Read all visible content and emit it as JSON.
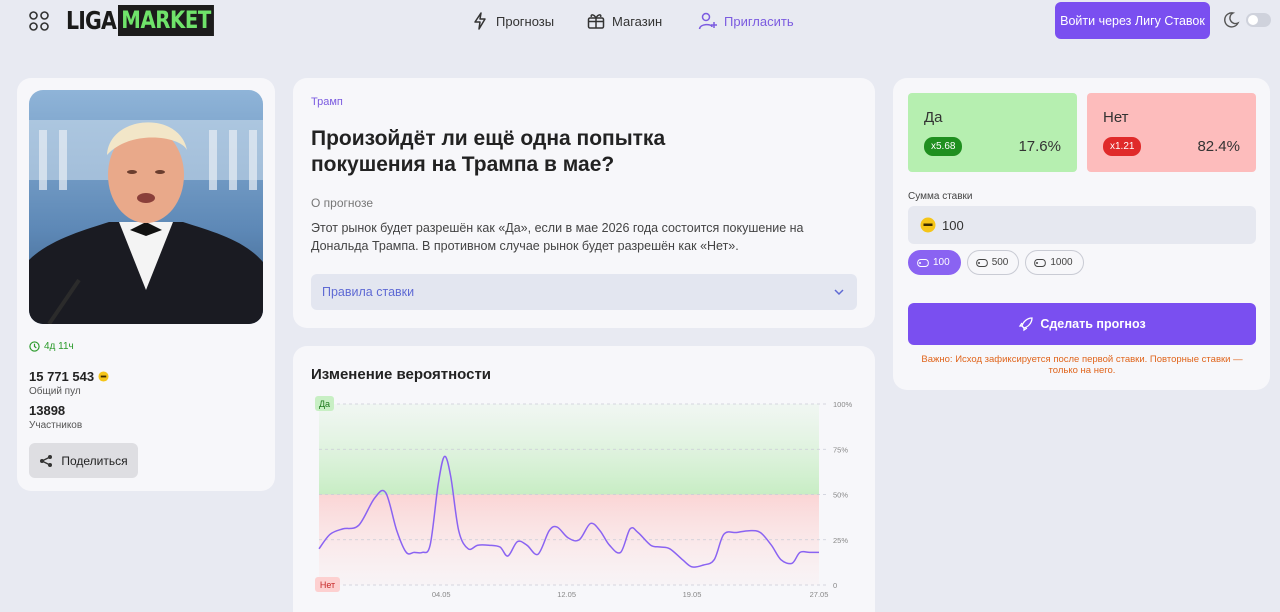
{
  "header": {
    "logo_left": "LIGA",
    "logo_right": "MARKET",
    "nav": [
      {
        "label": "Прогнозы",
        "icon": "lightning-icon"
      },
      {
        "label": "Магазин",
        "icon": "gift-icon"
      },
      {
        "label": "Пригласить",
        "icon": "add-user-icon"
      }
    ],
    "login_label": "Войти через Лигу Ставок"
  },
  "left": {
    "time_left": "4д 11ч",
    "pool_value": "15 771 543",
    "pool_label": "Общий пул",
    "participants_value": "13898",
    "participants_label": "Участников",
    "share_label": "Поделиться"
  },
  "market": {
    "tag": "Трамп",
    "title": "Произойдёт ли ещё одна попытка покушения на Трампа в мае?",
    "about_label": "О прогнозе",
    "about_text": "Этот рынок будет разрешён как «Да», если в мае 2026 года состоится покушение на Дональда Трампа. В противном случае рынок будет разрешён как «Нет».",
    "rules_label": "Правила ставки"
  },
  "chart_card": {
    "title": "Изменение вероятности"
  },
  "chart_data": {
    "type": "line",
    "title": "Изменение вероятности",
    "xlabel": "",
    "ylabel": "",
    "ylim": [
      0,
      100
    ],
    "y_ticks": [
      "0",
      "25%",
      "50%",
      "75%",
      "100%"
    ],
    "x_tick_labels": [
      "04.05",
      "12.05",
      "19.05",
      "27.05"
    ],
    "x_tick_positions": [
      9.2,
      17.1,
      25.0,
      33.0
    ],
    "x_range": [
      1.5,
      33.0
    ],
    "top_label": "Да",
    "bottom_label": "Нет",
    "series": [
      {
        "color": "#8a63f2",
        "x": [
          1.5,
          2.2,
          3.0,
          4.0,
          5.0,
          5.7,
          6.4,
          7.0,
          7.5,
          8.0,
          8.5,
          9.0,
          9.4,
          9.8,
          10.3,
          10.9,
          11.5,
          12.2,
          12.9,
          13.4,
          14.0,
          14.6,
          15.3,
          16.0,
          16.5,
          17.2,
          17.9,
          18.6,
          19.2,
          19.8,
          20.5,
          21.1,
          21.6,
          22.4,
          23.0,
          23.6,
          24.4,
          25.0,
          25.7,
          26.4,
          27.0,
          27.8,
          28.6,
          29.3,
          30.0,
          30.6,
          31.3,
          31.8,
          32.4,
          33.0
        ],
        "y": [
          20,
          28,
          31,
          33,
          48,
          51,
          30,
          18,
          18,
          18,
          22,
          55,
          71,
          60,
          30,
          20,
          22,
          22,
          21,
          16,
          24,
          22,
          17,
          30,
          32,
          26,
          25,
          34,
          30,
          22,
          18,
          31,
          29,
          22,
          21,
          20,
          14,
          10,
          11,
          14,
          28,
          29,
          30,
          29,
          22,
          14,
          12,
          18,
          18,
          18
        ]
      }
    ]
  },
  "bet": {
    "yes_label": "Да",
    "yes_mult": "x5.68",
    "yes_pct": "17.6%",
    "no_label": "Нет",
    "no_mult": "x1.21",
    "no_pct": "82.4%",
    "amount_label": "Сумма ставки",
    "amount_value": "100",
    "chips": [
      "100",
      "500",
      "1000"
    ],
    "submit_label": "Сделать прогноз",
    "warning": "Важно: Исход зафиксируется после первой ставки. Повторные ставки — только на него."
  },
  "colors": {
    "accent": "#7a4ff0",
    "yes": "#1f8f1f",
    "no": "#e02a2a",
    "warning": "#e0651c"
  }
}
